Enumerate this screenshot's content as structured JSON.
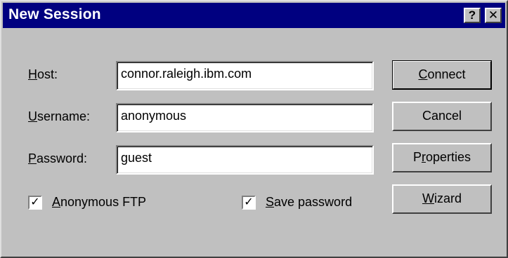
{
  "window": {
    "title": "New Session",
    "help_glyph": "?",
    "close_glyph": "✕"
  },
  "form": {
    "host_label_first": "H",
    "host_label_rest": "ost:",
    "host_value": "connor.raleigh.ibm.com",
    "username_label_first": "U",
    "username_label_rest": "sername:",
    "username_value": "anonymous",
    "password_label_first": "P",
    "password_label_rest": "assword:",
    "password_value": "guest"
  },
  "checkboxes": {
    "anon_ftp_first": "A",
    "anon_ftp_rest": "nonymous FTP",
    "anon_ftp_checked": true,
    "save_pw_first": "S",
    "save_pw_rest": "ave password",
    "save_pw_checked": true,
    "check_glyph": "✓"
  },
  "buttons": {
    "connect_first": "C",
    "connect_rest": "onnect",
    "cancel": "Cancel",
    "properties_pre": "P",
    "properties_u": "r",
    "properties_rest": "operties",
    "wizard_first": "W",
    "wizard_rest": "izard"
  },
  "colors": {
    "titlebar": "#000080",
    "dialog_face": "#c0c0c0"
  }
}
